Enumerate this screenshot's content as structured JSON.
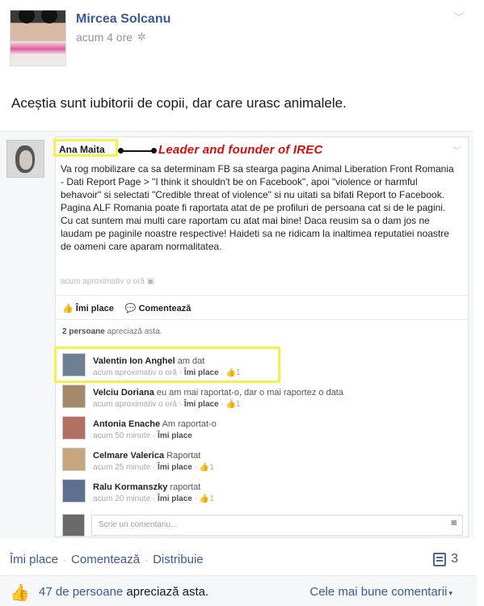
{
  "post": {
    "author": "Mircea Solcanu",
    "time": "acum 4 ore",
    "text": "Aceștia sunt iubitorii de copii, dar care urasc animalele."
  },
  "embed": {
    "author": "Ana Maita",
    "annotation": "Leader and founder of IREC",
    "body": "Va rog mobilizare ca sa determinam FB sa stearga pagina Animal Liberation Front Romania - Dati Report Page > \"I think it shouldn't be on Facebook\", apoi \"violence or harmful behavoir\" si selectati \"Credible threat of violence\" si nu uitati sa bifati Report to Facebook. Pagina ALF Romania poate fi raportata atat de pe profiluri de persoana cat si de le pagini. Cu cat suntem mai multi care raportam cu atat mai bine! Daca reusim sa o dam jos ne laudam pe paginile noastre respective! Haideti sa ne ridicam la inaltimea reputatiei noastre de oameni care aparam normalitatea.",
    "time": "acum aproximativ o oră",
    "like_label": "Îmi place",
    "comment_label": "Comentează",
    "like_count_strong": "2 persoane",
    "like_count_rest": " apreciază asta.",
    "comments": [
      {
        "name": "Valentin Ion Anghel",
        "text": " am dat",
        "time": "acum aproximativ o oră",
        "like": "Îmi place",
        "likes": "1"
      },
      {
        "name": "Velciu Doriana",
        "text": " eu am mai raportat-o, dar o mai raportez o data",
        "time": "acum aproximativ o oră",
        "like": "Îmi place",
        "likes": "1"
      },
      {
        "name": "Antonia Enache",
        "text": " Am raportat-o",
        "time": "acum 50 minute",
        "like": "Îmi place",
        "likes": ""
      },
      {
        "name": "Celmare Valerica",
        "text": " Raportat",
        "time": "acum 25 minute",
        "like": "Îmi place",
        "likes": "1"
      },
      {
        "name": "Ralu Kormanszky",
        "text": " raportat",
        "time": "acum 20 minute",
        "like": "Îmi place",
        "likes": "1"
      }
    ],
    "write_placeholder": "Scrie un comentariu..."
  },
  "footer": {
    "like": "Îmi place",
    "comment": "Comentează",
    "share": "Distribuie",
    "share_count": "3",
    "likes_number": "47 de persoane",
    "likes_rest": " apreciază asta.",
    "best_comments": "Cele mai bune comentarii"
  },
  "colors": {
    "link": "#3b5998",
    "highlight": "#f5f04a",
    "annotation": "#d10f0f"
  }
}
